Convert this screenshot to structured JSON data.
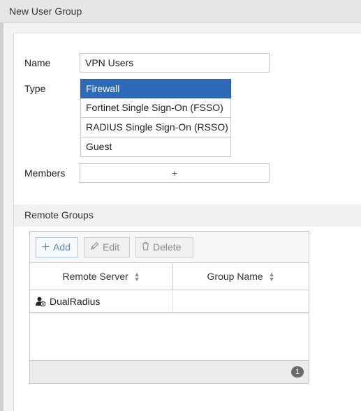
{
  "window": {
    "title": "New User Group"
  },
  "form": {
    "name_label": "Name",
    "name_value": "VPN Users",
    "type_label": "Type",
    "type_options": [
      {
        "label": "Firewall",
        "selected": true
      },
      {
        "label": "Fortinet Single Sign-On (FSSO)",
        "selected": false
      },
      {
        "label": "RADIUS Single Sign-On (RSSO)",
        "selected": false
      },
      {
        "label": "Guest",
        "selected": false
      }
    ],
    "members_label": "Members",
    "members_add": "+"
  },
  "remote_groups": {
    "title": "Remote Groups",
    "toolbar": {
      "add_label": "Add",
      "edit_label": "Edit",
      "delete_label": "Delete"
    },
    "columns": [
      "Remote Server",
      "Group Name"
    ],
    "rows": [
      {
        "remote_server": "DualRadius",
        "group_name": ""
      }
    ],
    "count": "1"
  },
  "icons": {
    "add": "plus-icon",
    "edit": "pencil-icon",
    "delete": "trash-icon",
    "sort": "sort-icon",
    "server": "radius-user-icon"
  },
  "colors": {
    "selected_bg": "#2f6ab8",
    "add_button_text": "#5b8ac0"
  }
}
